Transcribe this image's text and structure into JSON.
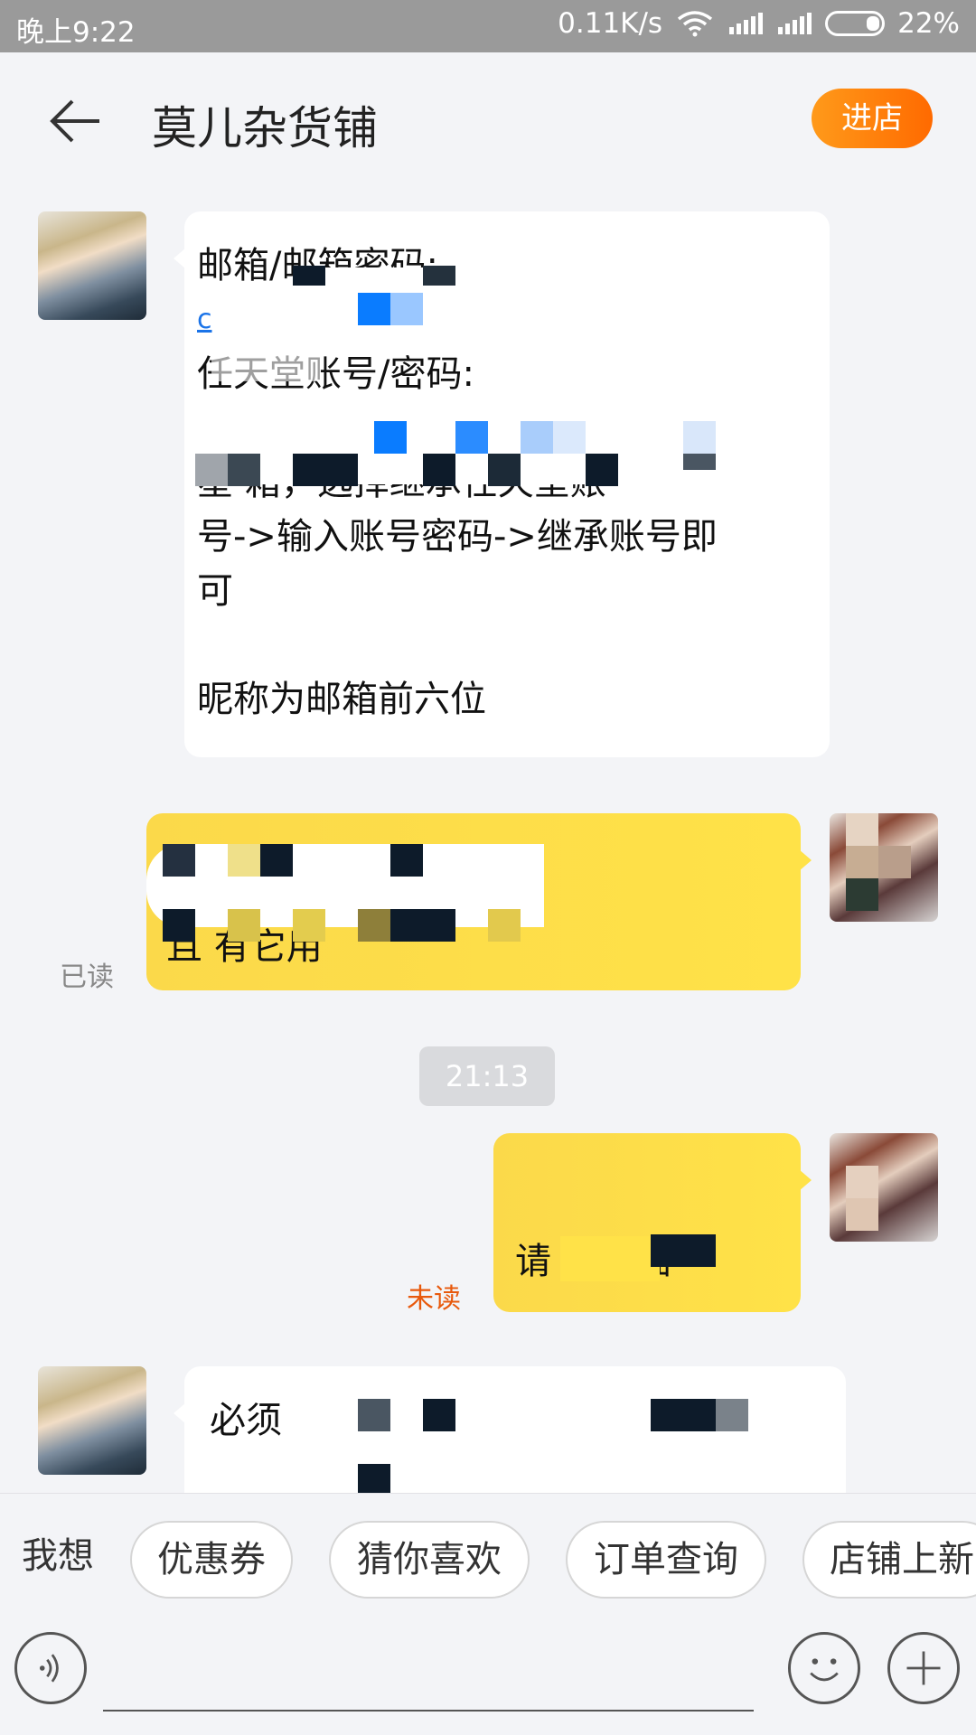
{
  "status_bar": {
    "time": "晚上9:22",
    "network_speed": "0.11K/s",
    "battery": "22%"
  },
  "header": {
    "shop_name": "莫儿杂货铺",
    "enter_shop_label": "进店"
  },
  "messages": [
    {
      "from": "seller",
      "lines": [
        "邮箱/邮箱密码:",
        "c",
        "任天堂账号/密码:",
        "",
        "星     箱，选择继承任天堂账",
        "号->输入账号密码->继承账号即",
        "可",
        "",
        "昵称为邮箱前六位"
      ]
    },
    {
      "from": "buyer",
      "status": "已读",
      "lines": [
        "",
        "且                    有它用"
      ]
    },
    {
      "from": "buyer",
      "status": "未读",
      "lines": [
        "请      去登陆"
      ]
    },
    {
      "from": "seller",
      "lines": [
        "必须"
      ]
    }
  ],
  "timestamp": "21:13",
  "quick_actions": {
    "label": "我想",
    "chips": [
      "优惠券",
      "猜你喜欢",
      "订单查询",
      "店铺上新"
    ]
  },
  "colors": {
    "accent": "#ff7a0a",
    "buyer_bubble": "#ffe248",
    "unread": "#e8590c",
    "read": "#888888"
  }
}
